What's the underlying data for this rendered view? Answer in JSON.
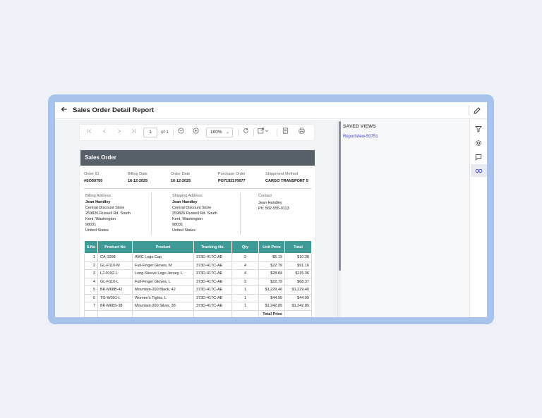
{
  "window": {
    "title": "Sales Order Detail Report"
  },
  "toolbar": {
    "page_value": "1",
    "page_total": "of 1",
    "zoom": "100%",
    "icons": [
      "first-page-icon",
      "prev-page-icon",
      "next-page-icon",
      "last-page-icon",
      "zoom-out-icon",
      "zoom-in-icon",
      "refresh-icon",
      "export-icon",
      "print-layout-icon",
      "print-icon"
    ]
  },
  "report": {
    "title": "Sales Order",
    "meta": [
      {
        "label": "Order ID",
        "value": "#SO50750"
      },
      {
        "label": "Billing Date",
        "value": "16-12-2025"
      },
      {
        "label": "Order Date",
        "value": "16-12-2025"
      },
      {
        "label": "Purchase Order",
        "value": "PO7192170677"
      },
      {
        "label": "Shippment Method",
        "value": "CARGO TRANSPORT 5"
      }
    ],
    "billing": {
      "label": "Billing Address",
      "name": "Jean Handley",
      "lines": [
        "Central Discount Store",
        "259826 Russell Rd. South",
        "Kent, Washington",
        "98031",
        "United States"
      ]
    },
    "shipping": {
      "label": "Shipping Address",
      "name": "Jean Handley",
      "lines": [
        "Central Discount Store",
        "259826 Russell Rd. South",
        "Kent, Washington",
        "98031",
        "United States"
      ]
    },
    "contact": {
      "label": "Contact",
      "lines": [
        "Jean Handley",
        "Ph: 582-555-0113"
      ]
    },
    "table": {
      "headers": [
        "S.No",
        "Product No",
        "Product",
        "Tracking No.",
        "Qty",
        "Unit Price",
        "Total"
      ],
      "rows": [
        [
          "1",
          "CA-1098",
          "AWC Logo Cap",
          "373D-417C-AE",
          "2",
          "$5.19",
          "$10.38"
        ],
        [
          "2",
          "GL-F110-M",
          "Full-Finger Gloves, M",
          "373D-417C-AE",
          "4",
          "$22.79",
          "$91.16"
        ],
        [
          "3",
          "LJ-0192-L",
          "Long-Sleeve Logo Jersey, L",
          "373D-417C-AE",
          "4",
          "$28.84",
          "$115.36"
        ],
        [
          "4",
          "GL-F110-L",
          "Full-Finger Gloves, L",
          "373D-417C-AE",
          "3",
          "$22.79",
          "$68.37"
        ],
        [
          "5",
          "BK-M68B-42",
          "Mountain-200 Black, 42",
          "373D-417C-AE",
          "1",
          "$1,229.46",
          "$1,229.46"
        ],
        [
          "6",
          "TG-W091-L",
          "Women's Tights, L",
          "373D-417C-AE",
          "1",
          "$44.99",
          "$44.99"
        ],
        [
          "7",
          "BK-M68S-38",
          "Mountain-200 Silver, 38",
          "373D-417C-AE",
          "1",
          "$1,242.85",
          "$1,242.85"
        ]
      ],
      "total_label": "Total Price"
    }
  },
  "saved_views": {
    "title": "SAVED VIEWS",
    "items": [
      "ReportView-50751"
    ]
  },
  "rail": {
    "icons": [
      "filter-icon",
      "settings-icon",
      "comment-icon",
      "link-icon"
    ],
    "active": "link-icon"
  },
  "colors": {
    "frame": "#a8c4ec",
    "header_bar": "#575f68",
    "table_header": "#3d9a97",
    "link": "#3a3ad6"
  }
}
